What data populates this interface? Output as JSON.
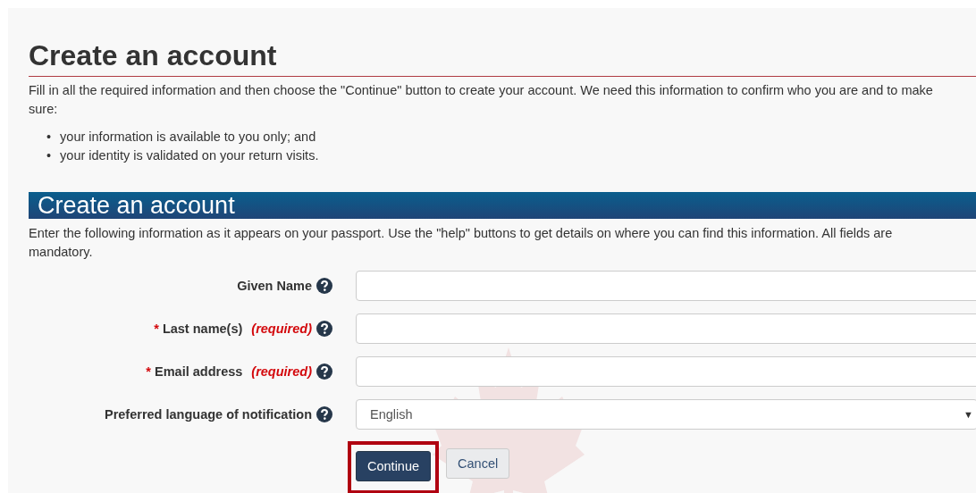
{
  "page_title": "Create an account",
  "intro": "Fill in all the required information and then choose the \"Continue\" button to create your account. We need this information to confirm who you are and to make sure:",
  "bullets": [
    {
      "marker": "•",
      "text": "your information is available to you only; and"
    },
    {
      "marker": "•",
      "text": "your identity is validated on your return visits."
    }
  ],
  "section": {
    "title": "Create an account",
    "instructions": "Enter the following information as it appears on your passport. Use the \"help\" buttons to get details on where you can find this information. All fields are mandatory."
  },
  "fields": [
    {
      "kind": "text",
      "label": "Given Name"
    },
    {
      "kind": "text",
      "label": "Last name(s)",
      "required_marker": "*",
      "required_note": "(required)"
    },
    {
      "kind": "text",
      "label": "Email address",
      "required_marker": "*",
      "required_note": "(required)"
    },
    {
      "kind": "select",
      "label": "Preferred language of notification",
      "value": "English",
      "caret": "▼"
    }
  ],
  "buttons": [
    {
      "label": "Continue",
      "kind": "primary",
      "highlighted": true
    },
    {
      "label": "Cancel",
      "kind": "default",
      "highlighted": false
    }
  ]
}
